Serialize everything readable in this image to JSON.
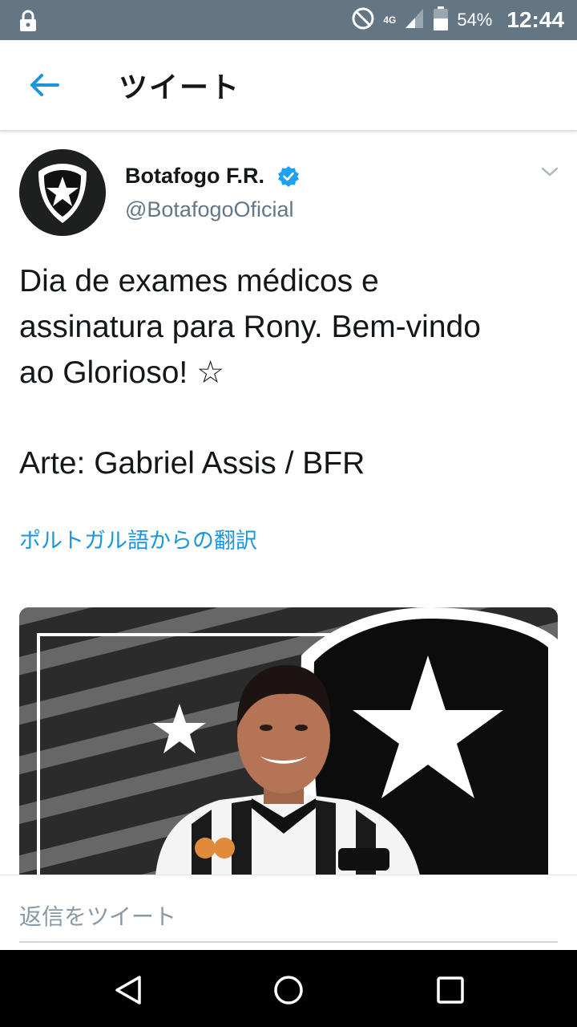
{
  "status_bar": {
    "network": "4G",
    "battery": "54%",
    "time": "12:44"
  },
  "header": {
    "title": "ツイート",
    "back_icon": "arrow-left-icon"
  },
  "tweet": {
    "author_name": "Botafogo F.R.",
    "author_handle": "@BotafogoOficial",
    "verified": true,
    "text_lines": [
      "Dia de exames médicos e",
      "assinatura para Rony. Bem-vindo",
      "ao Glorioso! ☆",
      "Arte: Gabriel Assis / BFR"
    ],
    "translate_label": "ポルトガル語からの翻訳"
  },
  "reply": {
    "placeholder": "返信をツイート"
  },
  "colors": {
    "status_bar": "#647684",
    "accent": "#1b95e0",
    "handle": "#657786"
  }
}
